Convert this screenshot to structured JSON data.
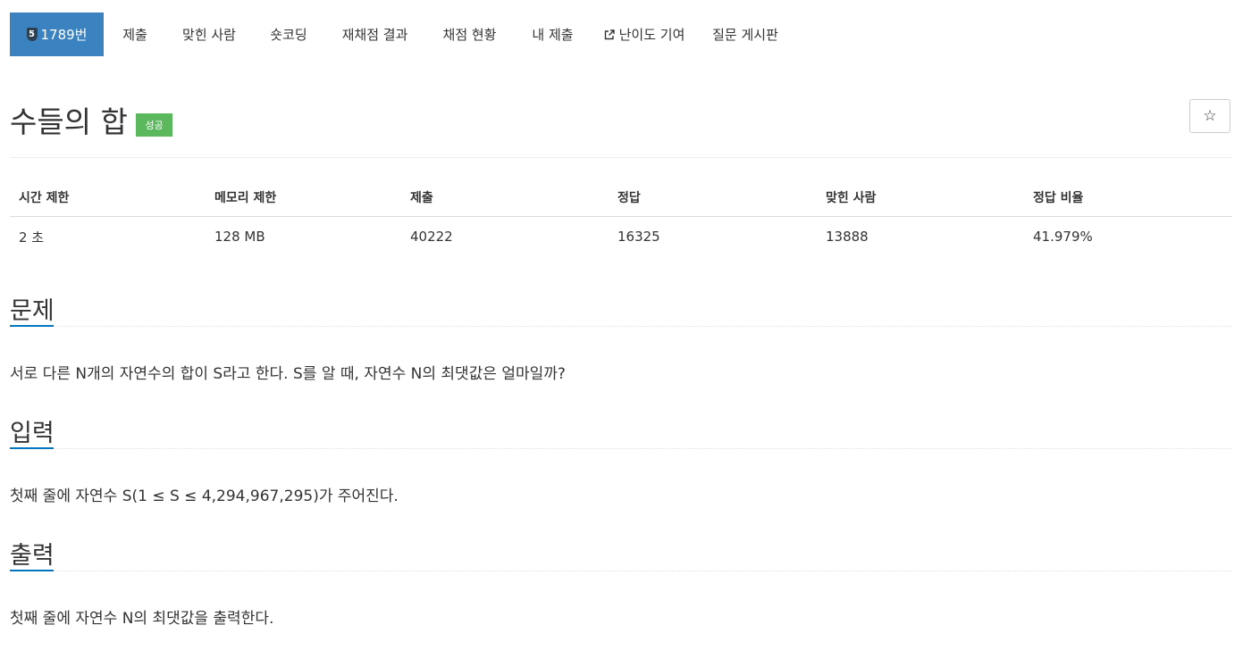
{
  "nav": {
    "problem_badge": "5",
    "problem_number": "1789번",
    "tabs": [
      "제출",
      "맞힌 사람",
      "숏코딩",
      "재채점 결과",
      "채점 현황",
      "내 제출",
      "난이도 기여",
      "질문 게시판"
    ]
  },
  "problem": {
    "title": "수들의 합",
    "status": "성공",
    "star": "☆"
  },
  "info_table": {
    "headers": [
      "시간 제한",
      "메모리 제한",
      "제출",
      "정답",
      "맞힌 사람",
      "정답 비율"
    ],
    "values": [
      "2 초",
      "128 MB",
      "40222",
      "16325",
      "13888",
      "41.979%"
    ]
  },
  "sections": {
    "description": {
      "title": "문제",
      "text": "서로 다른 N개의 자연수의 합이 S라고 한다. S를 알 때, 자연수 N의 최댓값은 얼마일까?"
    },
    "input": {
      "title": "입력",
      "text": "첫째 줄에 자연수 S(1 ≤ S ≤ 4,294,967,295)가 주어진다."
    },
    "output": {
      "title": "출력",
      "text": "첫째 줄에 자연수 N의 최댓값을 출력한다."
    }
  },
  "colors": {
    "active_tab": "#3b83c0",
    "success": "#5cb85c",
    "section_bar": "#0076c0"
  }
}
